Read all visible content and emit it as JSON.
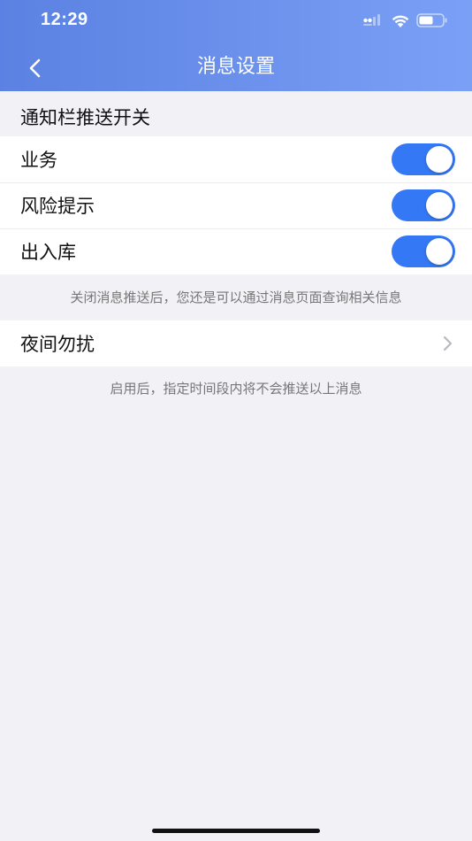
{
  "status_bar": {
    "time": "12:29"
  },
  "nav": {
    "title": "消息设置"
  },
  "notification_section": {
    "title": "通知栏推送开关",
    "items": [
      {
        "label": "业务",
        "enabled": true
      },
      {
        "label": "风险提示",
        "enabled": true
      },
      {
        "label": "出入库",
        "enabled": true
      }
    ],
    "hint": "关闭消息推送后，您还是可以通过消息页面查询相关信息"
  },
  "dnd_section": {
    "label": "夜间勿扰",
    "hint": "启用后，指定时间段内将不会推送以上消息"
  },
  "colors": {
    "header_start": "#5b81e2",
    "header_end": "#7aa0f6",
    "toggle_on": "#3478f6",
    "background": "#f1f1f6"
  },
  "icons": {
    "back": "chevron-left-icon",
    "disclosure": "chevron-right-icon",
    "signal": "cellular-signal-icon",
    "wifi": "wifi-icon",
    "battery": "battery-icon"
  }
}
